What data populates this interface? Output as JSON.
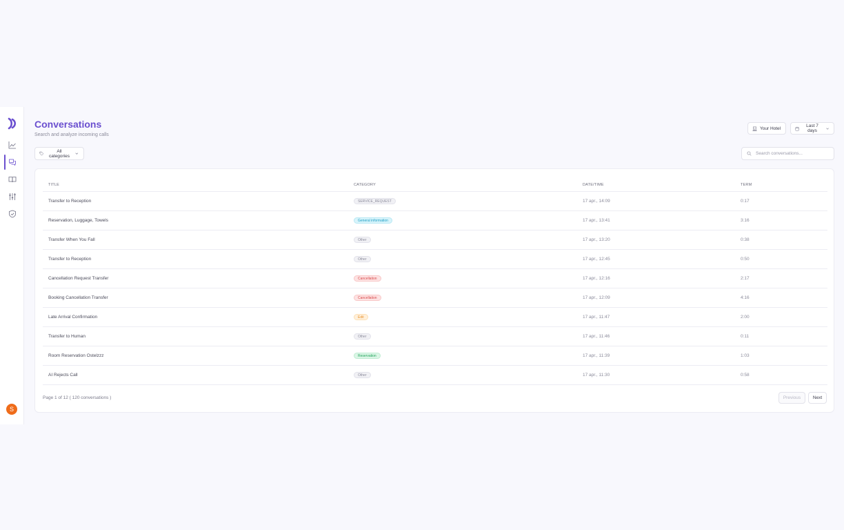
{
  "header": {
    "title": "Conversations",
    "subtitle": "Search and analyze incoming calls",
    "hotel_label": "Your Hotel",
    "range_label": "Last 7 days"
  },
  "filters": {
    "category_label": "All categories",
    "search_placeholder": "Search conversations..."
  },
  "table": {
    "columns": [
      "TITLE",
      "CATEGORY",
      "DATE/TIME",
      "TERM"
    ],
    "rows": [
      {
        "title": "Transfer to Reception",
        "category": "SERVICE_REQUEST",
        "color": "gray",
        "date": "17 apr., 14:09",
        "term": "0:17"
      },
      {
        "title": "Reservation, Luggage, Towels",
        "category": "General information",
        "color": "blue",
        "date": "17 apr., 13:41",
        "term": "3:16"
      },
      {
        "title": "Transfer When You Fall",
        "category": "Other",
        "color": "gray",
        "date": "17 apr., 13:20",
        "term": "0:38"
      },
      {
        "title": "Transfer to Reception",
        "category": "Other",
        "color": "gray",
        "date": "17 apr., 12:45",
        "term": "0:50"
      },
      {
        "title": "Cancellation Request Transfer",
        "category": "Cancellation",
        "color": "red",
        "date": "17 apr., 12:16",
        "term": "2:17"
      },
      {
        "title": "Booking Cancellation Transfer",
        "category": "Cancellation",
        "color": "red",
        "date": "17 apr., 12:09",
        "term": "4:16"
      },
      {
        "title": "Late Arrival Confirmation",
        "category": "Edit",
        "color": "orange",
        "date": "17 apr., 11:47",
        "term": "2:00"
      },
      {
        "title": "Transfer to Human",
        "category": "Other",
        "color": "gray",
        "date": "17 apr., 11:46",
        "term": "0:11"
      },
      {
        "title": "Room Reservation Ostelzzz",
        "category": "Reservation",
        "color": "green",
        "date": "17 apr., 11:39",
        "term": "1:03"
      },
      {
        "title": "AI Rejects Call",
        "category": "Other",
        "color": "gray",
        "date": "17 apr., 11:30",
        "term": "0:58"
      }
    ]
  },
  "pagination": {
    "summary": "Page 1 of 12 ( 120 conversations )",
    "previous_label": "Previous",
    "next_label": "Next"
  },
  "user": {
    "avatar_initial": "S"
  },
  "colors": {
    "accent": "#6a4fcf",
    "avatar": "#ef6c1a"
  }
}
